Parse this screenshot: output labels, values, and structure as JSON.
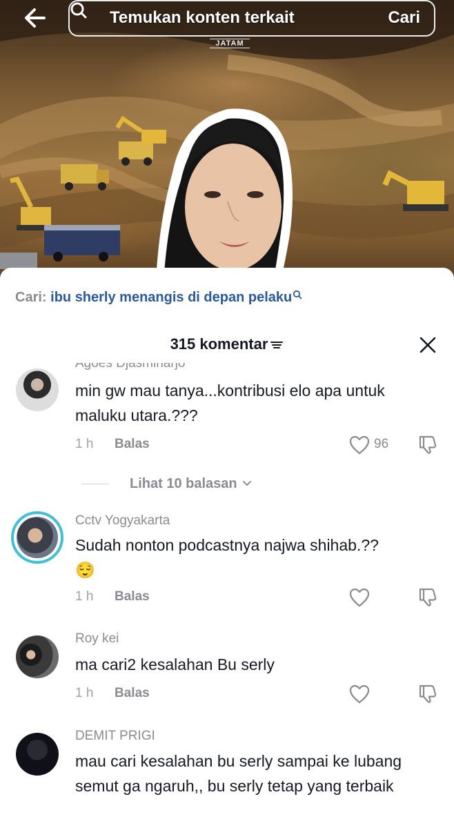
{
  "topbar": {
    "search_placeholder": "Temukan konten terkait",
    "search_button": "Cari"
  },
  "video": {
    "watermark_text": "JATAM"
  },
  "related_search": {
    "label": "Cari:",
    "query": "ibu sherly menangis di depan pelaku"
  },
  "comments_header": {
    "count_label": "315 komentar"
  },
  "comments": [
    {
      "username": "Agoes Djasminarjo",
      "text": "min gw mau tanya...kontribusi elo apa untuk maluku utara.???",
      "time": "1 h",
      "reply_label": "Balas",
      "likes": "96",
      "view_replies": "Lihat 10 balasan"
    },
    {
      "username": "Cctv Yogyakarta",
      "text": "Sudah nonton podcastnya najwa shihab.??",
      "emoji": "😌",
      "time": "1 h",
      "reply_label": "Balas"
    },
    {
      "username": "Roy kei",
      "text": "ma cari2 kesalahan Bu serly",
      "time": "1 h",
      "reply_label": "Balas"
    },
    {
      "username": "DEMIT PRIGI",
      "text": "mau cari kesalahan bu serly sampai ke lubang semut ga ngaruh,, bu serly tetap yang terbaik"
    }
  ],
  "colors": {
    "link_blue": "#2a5a9c",
    "muted_gray": "#8a8b91",
    "story_ring": "#3fc0d6"
  },
  "icons": [
    "back-arrow-icon",
    "search-icon",
    "sort-icon",
    "close-icon",
    "heart-icon",
    "dislike-icon",
    "chevron-down-icon"
  ]
}
